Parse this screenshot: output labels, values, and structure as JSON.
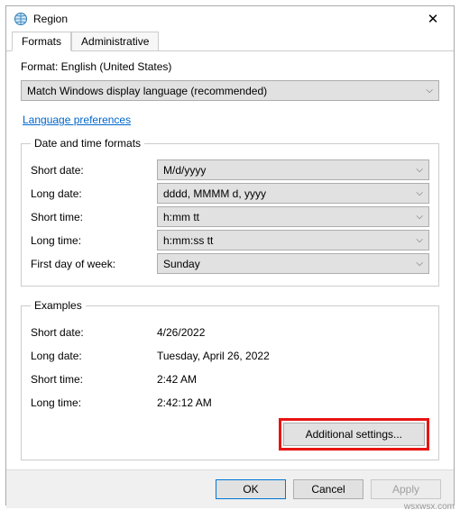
{
  "titlebar": {
    "title": "Region"
  },
  "tabs": {
    "formats": "Formats",
    "administrative": "Administrative"
  },
  "format": {
    "label": "Format: English (United States)",
    "selected": "Match Windows display language (recommended)"
  },
  "link": {
    "language_prefs": "Language preferences"
  },
  "dt_group": {
    "legend": "Date and time formats",
    "short_date": {
      "label": "Short date:",
      "value": "M/d/yyyy"
    },
    "long_date": {
      "label": "Long date:",
      "value": "dddd, MMMM d, yyyy"
    },
    "short_time": {
      "label": "Short time:",
      "value": "h:mm tt"
    },
    "long_time": {
      "label": "Long time:",
      "value": "h:mm:ss tt"
    },
    "first_day": {
      "label": "First day of week:",
      "value": "Sunday"
    }
  },
  "ex_group": {
    "legend": "Examples",
    "short_date": {
      "label": "Short date:",
      "value": "4/26/2022"
    },
    "long_date": {
      "label": "Long date:",
      "value": "Tuesday, April 26, 2022"
    },
    "short_time": {
      "label": "Short time:",
      "value": "2:42 AM"
    },
    "long_time": {
      "label": "Long time:",
      "value": "2:42:12 AM"
    }
  },
  "buttons": {
    "additional": "Additional settings...",
    "ok": "OK",
    "cancel": "Cancel",
    "apply": "Apply"
  },
  "watermark": "wsxwsx.com"
}
